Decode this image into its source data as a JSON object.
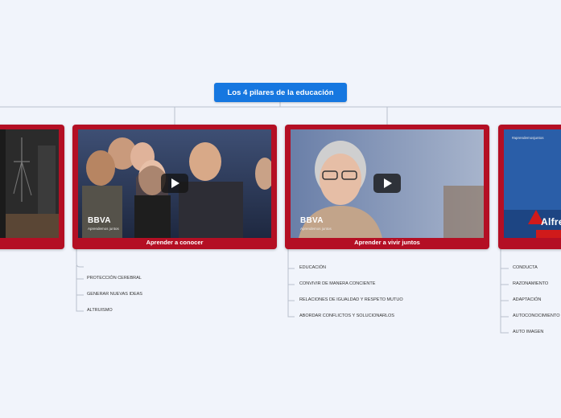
{
  "root": {
    "title": "Los 4 pilares de la educación"
  },
  "cards": [
    {
      "caption": "",
      "logo": "",
      "logo_sub": ""
    },
    {
      "caption": "Aprender a conocer",
      "logo": "BBVA",
      "logo_sub": "Aprendemos juntos"
    },
    {
      "caption": "Aprender a vivir juntos",
      "logo": "BBVA",
      "logo_sub": "Aprendemos juntos"
    },
    {
      "caption": "",
      "logo": "Alfre",
      "tag": "#aprendemosjuntos"
    }
  ],
  "branches": {
    "conocer": [
      "PROTECCIÓN CEREBRAL",
      "GENERAR NUEVAS IDEAS",
      "ALTRUISMO"
    ],
    "vivir": [
      "EDUCACIÓN",
      "CONVIVIR DE MANERA CONCIENTE",
      "RELACIONES DE IGUALDAD Y RESPETO MUTUO",
      "ABORDAR CONFLICTOS Y SOLUCIONARLOS"
    ],
    "ser": [
      "CONDUCTA",
      "RAZONAMIENTO",
      "ADAPTACIÓN",
      "AUTOCONOCIMIENTO",
      "AUTO IMAGEN"
    ]
  },
  "colors": {
    "root": "#1677e0",
    "card": "#b40f24",
    "connector": "#b9c0cc",
    "background": "#f1f4fb"
  }
}
